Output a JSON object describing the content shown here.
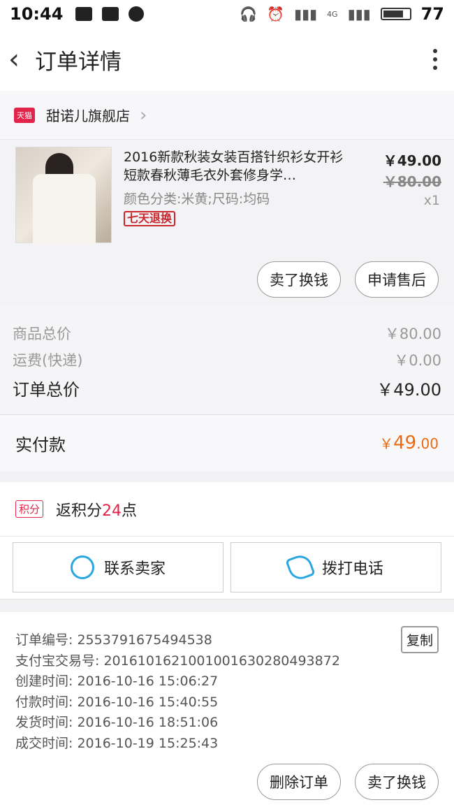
{
  "status_bar": {
    "time": "10:44",
    "battery": "77",
    "network": "4G"
  },
  "nav": {
    "title": "订单详情"
  },
  "shop": {
    "badge": "天猫",
    "name": "甜诺儿旗舰店"
  },
  "item": {
    "title": "2016新款秋装女装百搭针织衫女开衫短款春秋薄毛衣外套修身学…",
    "spec": "颜色分类:米黄;尺码:均码",
    "badge": "七天退换",
    "price": "￥49.00",
    "original_price": "￥80.00",
    "quantity": "x1",
    "buttons": [
      "卖了换钱",
      "申请售后"
    ]
  },
  "pricing": {
    "goods_total_label": "商品总价",
    "goods_total": "￥80.00",
    "shipping_label": "运费(快递)",
    "shipping": "￥0.00",
    "order_total_label": "订单总价",
    "order_total": "￥49.00",
    "paid_label": "实付款",
    "paid_symbol": "￥",
    "paid_int": "49",
    "paid_dec": ".00"
  },
  "points": {
    "badge": "积分",
    "prefix": "返积分",
    "num": "24",
    "suffix": "点"
  },
  "contact": {
    "seller": "联系卖家",
    "call": "拨打电话"
  },
  "order_info": {
    "copy": "复制",
    "lines": [
      "订单编号: 2553791675494538",
      "支付宝交易号: 2016101621001001630280493872",
      "创建时间: 2016-10-16 15:06:27",
      "付款时间: 2016-10-16 15:40:55",
      "发货时间: 2016-10-16 18:51:06",
      "成交时间: 2016-10-19 15:25:43"
    ]
  },
  "bottom": {
    "delete": "删除订单",
    "resell": "卖了换钱"
  },
  "colors": {
    "accent_red": "#e2234a",
    "paid_orange": "#ea6a12",
    "icon_blue": "#2aa7e1"
  }
}
